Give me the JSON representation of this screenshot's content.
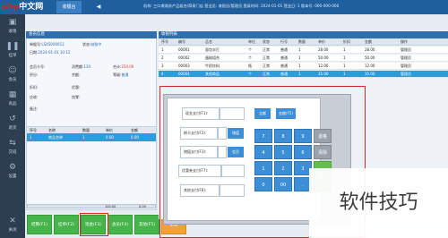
{
  "topbar": {
    "logo_php": "php",
    "logo_cn": "中文网",
    "tab1": "收银台",
    "tab2": "◀",
    "info": "机构: 三口甫湖苏产品组合/简易门店 营业员: 收银员/管理员 登录时间: 2024-01-01 营业日: 1 版本号: 000-000-000"
  },
  "nav": [
    "收银",
    "挂单",
    "会员",
    "商品",
    "退货",
    "交班",
    "设置",
    "关闭"
  ],
  "order_panel": {
    "header": "会员信息",
    "fields": [
      {
        "label": "单据号:",
        "value": "LSXS000012"
      },
      {
        "label": "状态:",
        "value": "结账中"
      },
      {
        "label": "日期:",
        "value": "2024-01-01 10:12"
      },
      {
        "label": "会员卡号:",
        "value": ""
      },
      {
        "label": "消费额:",
        "value": "130"
      },
      {
        "label": "合计:",
        "value": "250.00"
      },
      {
        "label": "积分:",
        "value": ""
      },
      {
        "label": "余额:",
        "value": ""
      },
      {
        "label": "等级:",
        "value": "普通"
      },
      {
        "label": "折扣:",
        "value": ""
      },
      {
        "label": "优惠:",
        "value": ""
      },
      {
        "label": "应收:",
        "value": ""
      },
      {
        "label": "找零:",
        "value": ""
      },
      {
        "label": "备注:",
        "value": ""
      }
    ],
    "table_head": [
      "序号",
      "名称",
      "数量",
      "单价",
      "金额"
    ],
    "row": [
      "1",
      "商品名称",
      "1",
      "0.00",
      "0.00"
    ],
    "scroll_values": [
      "100.00",
      "0.00"
    ]
  },
  "bottom_buttons": [
    "结算(F1)",
    "挂单(F2)",
    "现金(F3)",
    "会员(F4)",
    "其他(F5)",
    "退出"
  ],
  "main": {
    "header": "收银列表",
    "head": [
      "序号",
      "编号",
      "品名",
      "单位",
      "状态",
      "行号",
      "数量",
      "单价",
      "折扣",
      "金额",
      "操作"
    ],
    "rows": [
      [
        "1",
        "00001",
        "面包半打",
        "个",
        "正常",
        "普通",
        "1",
        "28.00",
        "1",
        "28.00",
        "管理员"
      ],
      [
        "2",
        "00002",
        "蛋糕组合",
        "个",
        "正常",
        "普通",
        "1",
        "50.00",
        "1",
        "50.00",
        "管理员"
      ],
      [
        "3",
        "00003",
        "牛奶饮料",
        "瓶",
        "正常",
        "普通",
        "1",
        "12.00",
        "1",
        "12.00",
        "管理员"
      ],
      [
        "4",
        "00004",
        "其他商品",
        "个",
        "正常",
        "普通",
        "1",
        "35.00",
        "1",
        "35.00",
        "管理员"
      ]
    ]
  },
  "dialog": {
    "field1": "现金支付(F1):",
    "field2": "刷卡支付(F2):",
    "field3": "储值支付(F3):",
    "field4": "优惠券支付(F7):",
    "field5": "其他支付(F8):",
    "btn_a": "全额",
    "btn_b": "金额(F5)",
    "btn_c": "储值",
    "btn_d": "会员",
    "keys": [
      "7",
      "8",
      "9",
      "4",
      "5",
      "6",
      "1",
      "2",
      "3",
      "0",
      "00",
      "."
    ],
    "key_back": "退格",
    "key_clear": "清除",
    "key_ok": "确定"
  },
  "watermark": "软件技巧"
}
